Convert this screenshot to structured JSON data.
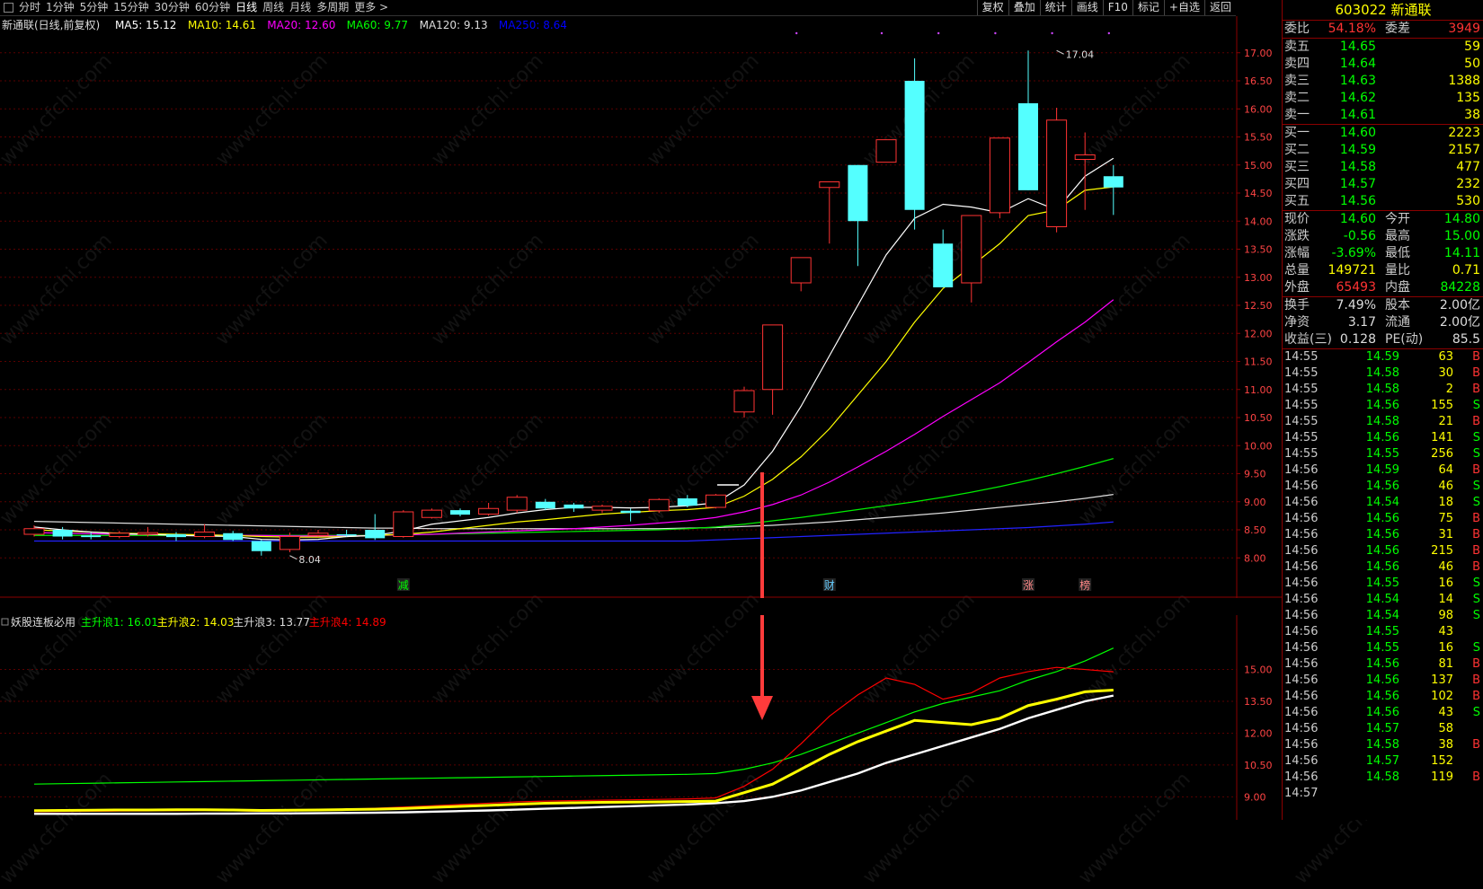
{
  "toolbar": {
    "tabs": [
      "分时",
      "1分钟",
      "5分钟",
      "15分钟",
      "30分钟",
      "60分钟",
      "日线",
      "周线",
      "月线",
      "多周期",
      "更多 >"
    ],
    "active_tab": "日线",
    "tools": [
      "复权",
      "叠加",
      "统计",
      "画线",
      "F10",
      "标记",
      "+自选",
      "返回"
    ]
  },
  "header": {
    "stock_name": "新通联(日线,前复权)",
    "ma_labels": [
      {
        "text": "MA5: 15.12",
        "color": "#ffffff"
      },
      {
        "text": "MA10: 14.61",
        "color": "#ffff00"
      },
      {
        "text": "MA20: 12.60",
        "color": "#ff00ff"
      },
      {
        "text": "MA60: 9.77",
        "color": "#00ff00"
      },
      {
        "text": "MA120: 9.13",
        "color": "#dddddd"
      },
      {
        "text": "MA250: 8.64",
        "color": "#0000ff"
      }
    ]
  },
  "chart_data": [
    {
      "type": "candlestick",
      "title": "新通联(日线,前复权)",
      "ylim": [
        7.7,
        17.3
      ],
      "y_ticks": [
        8.0,
        8.5,
        9.0,
        9.5,
        10.0,
        10.5,
        11.0,
        11.5,
        12.0,
        12.5,
        13.0,
        13.5,
        14.0,
        14.5,
        15.0,
        15.5,
        16.0,
        16.5,
        17.0
      ],
      "annotations": [
        {
          "text": "8.04",
          "index": 9,
          "price": 8.04
        },
        {
          "text": "17.04",
          "index": 36,
          "price": 17.04
        }
      ],
      "markers": [
        {
          "text": "减",
          "index": 13
        },
        {
          "text": "财",
          "index": 28
        },
        {
          "text": "涨",
          "index": 35
        },
        {
          "text": "榜",
          "index": 37
        }
      ],
      "candles": [
        {
          "o": 8.42,
          "c": 8.52,
          "h": 8.58,
          "l": 8.38
        },
        {
          "o": 8.5,
          "c": 8.38,
          "h": 8.55,
          "l": 8.33
        },
        {
          "o": 8.4,
          "c": 8.37,
          "h": 8.45,
          "l": 8.33
        },
        {
          "o": 8.38,
          "c": 8.44,
          "h": 8.48,
          "l": 8.35
        },
        {
          "o": 8.42,
          "c": 8.45,
          "h": 8.55,
          "l": 8.38
        },
        {
          "o": 8.42,
          "c": 8.37,
          "h": 8.46,
          "l": 8.3
        },
        {
          "o": 8.38,
          "c": 8.46,
          "h": 8.6,
          "l": 8.35
        },
        {
          "o": 8.44,
          "c": 8.32,
          "h": 8.48,
          "l": 8.3
        },
        {
          "o": 8.3,
          "c": 8.12,
          "h": 8.32,
          "l": 8.04
        },
        {
          "o": 8.15,
          "c": 8.38,
          "h": 8.45,
          "l": 8.1
        },
        {
          "o": 8.4,
          "c": 8.44,
          "h": 8.5,
          "l": 8.38
        },
        {
          "o": 8.42,
          "c": 8.4,
          "h": 8.5,
          "l": 8.38
        },
        {
          "o": 8.5,
          "c": 8.35,
          "h": 8.78,
          "l": 8.32
        },
        {
          "o": 8.38,
          "c": 8.82,
          "h": 8.85,
          "l": 8.36
        },
        {
          "o": 8.72,
          "c": 8.85,
          "h": 8.88,
          "l": 8.7
        },
        {
          "o": 8.85,
          "c": 8.77,
          "h": 8.88,
          "l": 8.74
        },
        {
          "o": 8.78,
          "c": 8.88,
          "h": 8.98,
          "l": 8.75
        },
        {
          "o": 8.85,
          "c": 9.08,
          "h": 9.12,
          "l": 8.8
        },
        {
          "o": 9.0,
          "c": 8.88,
          "h": 9.05,
          "l": 8.85
        },
        {
          "o": 8.95,
          "c": 8.88,
          "h": 8.98,
          "l": 8.82
        },
        {
          "o": 8.85,
          "c": 8.92,
          "h": 8.95,
          "l": 8.8
        },
        {
          "o": 8.84,
          "c": 8.8,
          "h": 8.88,
          "l": 8.65
        },
        {
          "o": 8.84,
          "c": 9.04,
          "h": 9.06,
          "l": 8.8
        },
        {
          "o": 9.06,
          "c": 8.93,
          "h": 9.12,
          "l": 8.9
        },
        {
          "o": 8.9,
          "c": 9.12,
          "h": 9.14,
          "l": 8.88
        },
        {
          "o": 10.6,
          "c": 10.98,
          "h": 11.05,
          "l": 10.5
        },
        {
          "o": 11.0,
          "c": 12.15,
          "h": 12.15,
          "l": 10.55
        },
        {
          "o": 12.9,
          "c": 13.35,
          "h": 13.35,
          "l": 12.75
        },
        {
          "o": 14.6,
          "c": 14.7,
          "h": 14.7,
          "l": 13.6
        },
        {
          "o": 15.0,
          "c": 14.0,
          "h": 15.0,
          "l": 13.2
        },
        {
          "o": 15.05,
          "c": 15.45,
          "h": 15.45,
          "l": 15.05
        },
        {
          "o": 16.5,
          "c": 14.2,
          "h": 16.9,
          "l": 13.85
        },
        {
          "o": 13.6,
          "c": 12.82,
          "h": 13.85,
          "l": 12.82
        },
        {
          "o": 12.9,
          "c": 14.1,
          "h": 14.1,
          "l": 12.55
        },
        {
          "o": 14.15,
          "c": 15.48,
          "h": 15.48,
          "l": 14.05
        },
        {
          "o": 16.1,
          "c": 14.55,
          "h": 17.04,
          "l": 14.55
        },
        {
          "o": 13.9,
          "c": 15.8,
          "h": 16.02,
          "l": 13.8
        },
        {
          "o": 15.1,
          "c": 15.18,
          "h": 15.58,
          "l": 14.2
        },
        {
          "o": 14.8,
          "c": 14.6,
          "h": 15.0,
          "l": 14.11
        }
      ],
      "ma5": [
        8.55,
        8.5,
        8.46,
        8.43,
        8.42,
        8.4,
        8.39,
        8.38,
        8.33,
        8.32,
        8.33,
        8.38,
        8.4,
        8.48,
        8.6,
        8.66,
        8.72,
        8.8,
        8.86,
        8.9,
        8.9,
        8.89,
        8.9,
        8.93,
        8.98,
        9.3,
        9.9,
        10.7,
        11.6,
        12.5,
        13.4,
        14.05,
        14.3,
        14.25,
        14.15,
        14.4,
        14.2,
        14.8,
        15.12
      ],
      "ma10": [
        8.5,
        8.48,
        8.46,
        8.44,
        8.43,
        8.42,
        8.41,
        8.4,
        8.38,
        8.37,
        8.37,
        8.38,
        8.4,
        8.42,
        8.46,
        8.52,
        8.58,
        8.64,
        8.68,
        8.73,
        8.78,
        8.81,
        8.84,
        8.86,
        8.9,
        9.1,
        9.4,
        9.8,
        10.3,
        10.9,
        11.5,
        12.2,
        12.8,
        13.2,
        13.6,
        14.1,
        14.2,
        14.55,
        14.61
      ],
      "ma20": [
        8.45,
        8.44,
        8.43,
        8.42,
        8.42,
        8.41,
        8.41,
        8.4,
        8.4,
        8.39,
        8.39,
        8.39,
        8.4,
        8.41,
        8.42,
        8.44,
        8.46,
        8.48,
        8.5,
        8.52,
        8.55,
        8.58,
        8.62,
        8.66,
        8.72,
        8.82,
        8.95,
        9.12,
        9.35,
        9.62,
        9.9,
        10.2,
        10.52,
        10.82,
        11.12,
        11.48,
        11.85,
        12.2,
        12.6
      ],
      "ma60": [
        8.4,
        8.4,
        8.4,
        8.4,
        8.4,
        8.4,
        8.4,
        8.4,
        8.4,
        8.4,
        8.4,
        8.4,
        8.4,
        8.41,
        8.42,
        8.43,
        8.44,
        8.45,
        8.46,
        8.47,
        8.48,
        8.49,
        8.5,
        8.52,
        8.55,
        8.6,
        8.66,
        8.72,
        8.79,
        8.86,
        8.93,
        9.0,
        9.08,
        9.17,
        9.27,
        9.38,
        9.5,
        9.63,
        9.77
      ],
      "ma120": [
        8.65,
        8.64,
        8.63,
        8.62,
        8.61,
        8.6,
        8.59,
        8.58,
        8.57,
        8.56,
        8.55,
        8.54,
        8.53,
        8.53,
        8.52,
        8.52,
        8.52,
        8.52,
        8.52,
        8.52,
        8.52,
        8.52,
        8.52,
        8.53,
        8.54,
        8.56,
        8.58,
        8.61,
        8.64,
        8.68,
        8.72,
        8.76,
        8.8,
        8.85,
        8.9,
        8.95,
        9.0,
        9.06,
        9.13
      ],
      "ma250": [
        8.3,
        8.3,
        8.3,
        8.3,
        8.3,
        8.3,
        8.3,
        8.3,
        8.3,
        8.3,
        8.3,
        8.3,
        8.3,
        8.3,
        8.3,
        8.3,
        8.3,
        8.3,
        8.3,
        8.3,
        8.3,
        8.3,
        8.3,
        8.3,
        8.32,
        8.34,
        8.36,
        8.38,
        8.4,
        8.42,
        8.44,
        8.46,
        8.48,
        8.5,
        8.52,
        8.54,
        8.57,
        8.6,
        8.64
      ]
    },
    {
      "type": "line",
      "title": "妖股连板必用",
      "ylim": [
        8.0,
        16.8
      ],
      "y_ticks": [
        9.0,
        10.5,
        12.0,
        13.5,
        15.0
      ],
      "series": [
        {
          "name": "主升浪1",
          "value_label": "主升浪1: 16.01",
          "color": "#00ff00",
          "values": [
            9.6,
            9.62,
            9.64,
            9.66,
            9.68,
            9.7,
            9.72,
            9.74,
            9.76,
            9.78,
            9.8,
            9.82,
            9.84,
            9.86,
            9.88,
            9.9,
            9.92,
            9.94,
            9.96,
            9.98,
            10.0,
            10.02,
            10.04,
            10.06,
            10.1,
            10.3,
            10.6,
            11.0,
            11.5,
            12.0,
            12.5,
            13.0,
            13.4,
            13.7,
            14.0,
            14.5,
            14.9,
            15.4,
            16.01
          ]
        },
        {
          "name": "主升浪2",
          "value_label": "主升浪2: 14.03",
          "color": "#ffff00",
          "values": [
            8.35,
            8.36,
            8.37,
            8.38,
            8.38,
            8.39,
            8.39,
            8.38,
            8.36,
            8.37,
            8.38,
            8.4,
            8.42,
            8.45,
            8.5,
            8.55,
            8.6,
            8.65,
            8.7,
            8.72,
            8.74,
            8.75,
            8.76,
            8.78,
            8.8,
            9.2,
            9.6,
            10.3,
            11.0,
            11.6,
            12.1,
            12.6,
            12.5,
            12.4,
            12.7,
            13.3,
            13.6,
            13.95,
            14.03
          ]
        },
        {
          "name": "主升浪3",
          "value_label": "主升浪3: 13.77",
          "color": "#ffffff",
          "values": [
            8.2,
            8.2,
            8.2,
            8.2,
            8.2,
            8.2,
            8.21,
            8.21,
            8.22,
            8.22,
            8.23,
            8.24,
            8.25,
            8.27,
            8.3,
            8.33,
            8.36,
            8.4,
            8.44,
            8.48,
            8.52,
            8.56,
            8.6,
            8.64,
            8.7,
            8.8,
            9.0,
            9.3,
            9.7,
            10.1,
            10.6,
            11.0,
            11.4,
            11.8,
            12.2,
            12.7,
            13.1,
            13.5,
            13.77
          ]
        },
        {
          "name": "主升浪4",
          "value_label": "主升浪4: 14.89",
          "color": "#ff0000",
          "values": [
            8.3,
            8.31,
            8.32,
            8.33,
            8.34,
            8.35,
            8.36,
            8.35,
            8.32,
            8.34,
            8.38,
            8.42,
            8.46,
            8.52,
            8.58,
            8.64,
            8.7,
            8.76,
            8.8,
            8.82,
            8.84,
            8.86,
            8.88,
            8.9,
            8.95,
            9.5,
            10.3,
            11.5,
            12.8,
            13.8,
            14.6,
            14.3,
            13.6,
            13.9,
            14.6,
            14.9,
            15.1,
            15.0,
            14.89
          ]
        }
      ]
    }
  ],
  "quote": {
    "code": "603022",
    "name": "新通联",
    "weibi": {
      "label": "委比",
      "value": "54.18%",
      "label2": "委差",
      "value2": "3949"
    },
    "sells": [
      {
        "label": "卖五",
        "price": "14.65",
        "vol": "59"
      },
      {
        "label": "卖四",
        "price": "14.64",
        "vol": "50"
      },
      {
        "label": "卖三",
        "price": "14.63",
        "vol": "1388"
      },
      {
        "label": "卖二",
        "price": "14.62",
        "vol": "135"
      },
      {
        "label": "卖一",
        "price": "14.61",
        "vol": "38"
      }
    ],
    "buys": [
      {
        "label": "买一",
        "price": "14.60",
        "vol": "2223"
      },
      {
        "label": "买二",
        "price": "14.59",
        "vol": "2157"
      },
      {
        "label": "买三",
        "price": "14.58",
        "vol": "477"
      },
      {
        "label": "买四",
        "price": "14.57",
        "vol": "232"
      },
      {
        "label": "买五",
        "price": "14.56",
        "vol": "530"
      }
    ],
    "stats": [
      {
        "l1": "现价",
        "v1": "14.60",
        "c1": "#00ff00",
        "l2": "今开",
        "v2": "14.80",
        "c2": "#00ff00"
      },
      {
        "l1": "涨跌",
        "v1": "-0.56",
        "c1": "#00ff00",
        "l2": "最高",
        "v2": "15.00",
        "c2": "#00ff00"
      },
      {
        "l1": "涨幅",
        "v1": "-3.69%",
        "c1": "#00ff00",
        "l2": "最低",
        "v2": "14.11",
        "c2": "#00ff00"
      },
      {
        "l1": "总量",
        "v1": "149721",
        "c1": "#ffff00",
        "l2": "量比",
        "v2": "0.71",
        "c2": "#ffff00"
      },
      {
        "l1": "外盘",
        "v1": "65493",
        "c1": "#ff3333",
        "l2": "内盘",
        "v2": "84228",
        "c2": "#00ff00"
      }
    ],
    "stats2": [
      {
        "l1": "换手",
        "v1": "7.49%",
        "l2": "股本",
        "v2": "2.00亿"
      },
      {
        "l1": "净资",
        "v1": "3.17",
        "l2": "流通",
        "v2": "2.00亿"
      },
      {
        "l1": "收益(三)",
        "v1": "0.128",
        "l2": "PE(动)",
        "v2": "85.5"
      }
    ],
    "ticks": [
      {
        "t": "14:55",
        "p": "14.59",
        "v": "63",
        "bs": "B"
      },
      {
        "t": "14:55",
        "p": "14.58",
        "v": "30",
        "bs": "B"
      },
      {
        "t": "14:55",
        "p": "14.58",
        "v": "2",
        "bs": "B"
      },
      {
        "t": "14:55",
        "p": "14.56",
        "v": "155",
        "bs": "S"
      },
      {
        "t": "14:55",
        "p": "14.58",
        "v": "21",
        "bs": "B"
      },
      {
        "t": "14:55",
        "p": "14.56",
        "v": "141",
        "bs": "S"
      },
      {
        "t": "14:55",
        "p": "14.55",
        "v": "256",
        "bs": "S"
      },
      {
        "t": "14:56",
        "p": "14.59",
        "v": "64",
        "bs": "B"
      },
      {
        "t": "14:56",
        "p": "14.56",
        "v": "46",
        "bs": "S"
      },
      {
        "t": "14:56",
        "p": "14.54",
        "v": "18",
        "bs": "S"
      },
      {
        "t": "14:56",
        "p": "14.56",
        "v": "75",
        "bs": "B"
      },
      {
        "t": "14:56",
        "p": "14.56",
        "v": "31",
        "bs": "B"
      },
      {
        "t": "14:56",
        "p": "14.56",
        "v": "215",
        "bs": "B"
      },
      {
        "t": "14:56",
        "p": "14.56",
        "v": "46",
        "bs": "B"
      },
      {
        "t": "14:56",
        "p": "14.55",
        "v": "16",
        "bs": "S"
      },
      {
        "t": "14:56",
        "p": "14.54",
        "v": "14",
        "bs": "S"
      },
      {
        "t": "14:56",
        "p": "14.54",
        "v": "98",
        "bs": "S"
      },
      {
        "t": "14:56",
        "p": "14.55",
        "v": "43",
        "bs": ""
      },
      {
        "t": "14:56",
        "p": "14.55",
        "v": "16",
        "bs": "S"
      },
      {
        "t": "14:56",
        "p": "14.56",
        "v": "81",
        "bs": "B"
      },
      {
        "t": "14:56",
        "p": "14.56",
        "v": "137",
        "bs": "B"
      },
      {
        "t": "14:56",
        "p": "14.56",
        "v": "102",
        "bs": "B"
      },
      {
        "t": "14:56",
        "p": "14.56",
        "v": "43",
        "bs": "S"
      },
      {
        "t": "14:56",
        "p": "14.57",
        "v": "58",
        "bs": ""
      },
      {
        "t": "14:56",
        "p": "14.58",
        "v": "38",
        "bs": "B"
      },
      {
        "t": "14:56",
        "p": "14.57",
        "v": "152",
        "bs": ""
      },
      {
        "t": "14:56",
        "p": "14.58",
        "v": "119",
        "bs": "B"
      },
      {
        "t": "14:57",
        "p": "",
        "v": "",
        "bs": ""
      }
    ]
  },
  "colors": {
    "up": "#ff3333",
    "down": "#54ffff",
    "grid": "#5a0000",
    "axis": "#8b0000",
    "arrow": "#ff3b3b"
  },
  "watermark": "www.cfchi.com"
}
